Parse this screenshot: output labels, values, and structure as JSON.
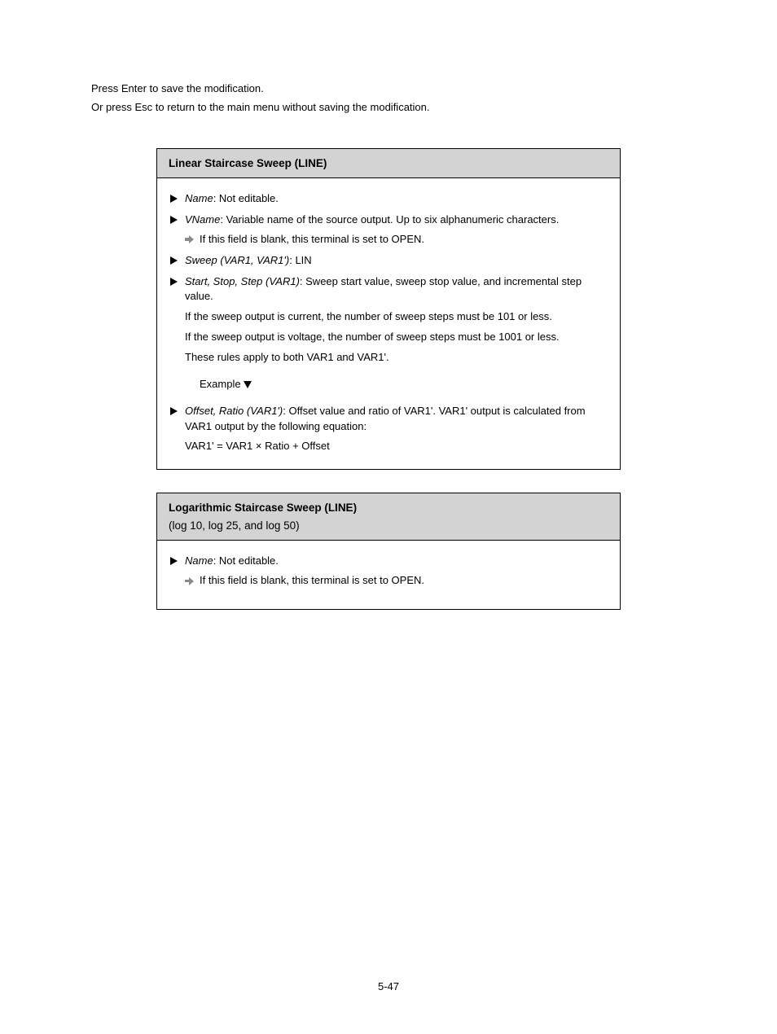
{
  "intro": {
    "line1_pre": "Press ",
    "line1_btn": "Enter",
    "line1_post": " to save the modification.",
    "line2_pre": "Or press ",
    "line2_btn": "Esc",
    "line2_post": " to return to the main menu without saving the modification."
  },
  "box1": {
    "title": "Linear Staircase Sweep (LINE)",
    "items": [
      {
        "type": "main",
        "pre": "",
        "key": "Name",
        "post": ": Not editable."
      },
      {
        "type": "main",
        "pre": "",
        "key": "VName",
        "post": ": Variable name of the source output. Up to six alphanumeric characters."
      },
      {
        "type": "sub",
        "text": "If this field is blank, this terminal is set to OPEN."
      },
      {
        "type": "main",
        "pre": "",
        "key": "Sweep (VAR1, VAR1')",
        "post": ": LIN"
      },
      {
        "type": "main",
        "pre": "",
        "key": "Start, Stop, Step (VAR1)",
        "post": ": Sweep start value, sweep stop value, and incremental step value."
      },
      {
        "type": "para",
        "pre": "If the sweep output is ",
        "link": "current",
        "post": ", the number of sweep steps must be 101 or less."
      },
      {
        "type": "para",
        "pre": "If the sweep output is ",
        "link": "voltage",
        "post": ", the number of sweep steps must be 1001 or less."
      },
      {
        "type": "para",
        "text": "These rules apply to both VAR1 and VAR1'."
      },
      {
        "type": "heading",
        "text": "Example"
      },
      {
        "type": "main",
        "pre": "",
        "key": "Offset, Ratio (VAR1')",
        "post": ": Offset value and ratio of VAR1'. VAR1' output is calculated from VAR1 output by the following equation:"
      },
      {
        "type": "para",
        "text": "VAR1' = VAR1 × Ratio + Offset"
      }
    ]
  },
  "box2": {
    "title": "Logarithmic Staircase Sweep (LINE)",
    "subtitle": "(log 10, log 25, and log 50)",
    "items": [
      {
        "type": "main",
        "pre": "",
        "key": "Name",
        "post": ": Not editable."
      },
      {
        "type": "sub",
        "text": "If this field is blank, this terminal is set to OPEN."
      }
    ]
  },
  "page_number": "5-47"
}
